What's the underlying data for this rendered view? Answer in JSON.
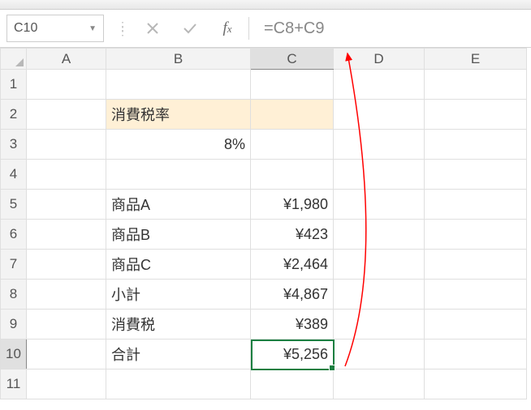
{
  "nameBox": "C10",
  "formula": "=C8+C9",
  "columns": [
    "A",
    "B",
    "C",
    "D",
    "E"
  ],
  "rows": [
    "1",
    "2",
    "3",
    "4",
    "5",
    "6",
    "7",
    "8",
    "9",
    "10",
    "11"
  ],
  "cells": {
    "B2": "消費税率",
    "B3": "8%",
    "B5": "商品A",
    "C5": "¥1,980",
    "B6": "商品B",
    "C6": "¥423",
    "B7": "商品C",
    "C7": "¥2,464",
    "B8": "小計",
    "C8": "¥4,867",
    "B9": "消費税",
    "C9": "¥389",
    "B10": "合計",
    "C10": "¥5,256"
  },
  "selectedCell": "C10"
}
